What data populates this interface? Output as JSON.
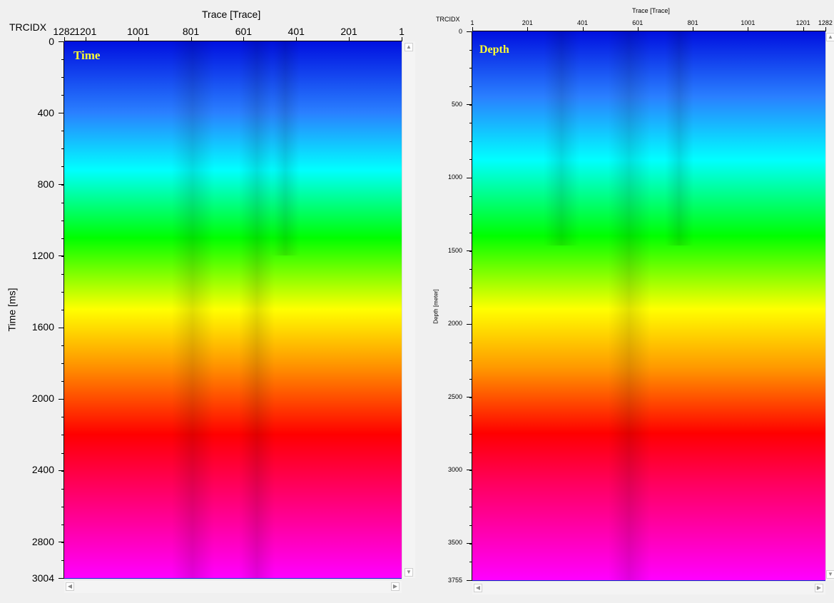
{
  "chart_data": [
    {
      "type": "heatmap",
      "title": "Time",
      "xlabel": "Trace [Trace]",
      "ylabel": "Time [ms]",
      "corner_label": "TRCIDX",
      "x_direction": "reversed",
      "xlim": [
        1282,
        1
      ],
      "ylim": [
        0,
        3004
      ],
      "x_ticks": [
        "1282",
        "1201",
        "1001",
        "801",
        "601",
        "401",
        "201",
        "1"
      ],
      "y_ticks": [
        "0",
        "400",
        "800",
        "1200",
        "1600",
        "2000",
        "2400",
        "2800",
        "3004"
      ],
      "y_tick_values": [
        0,
        400,
        800,
        1200,
        1600,
        2000,
        2400,
        2800,
        3004
      ],
      "color_bands": [
        {
          "color": "#0010e0",
          "value": 0
        },
        {
          "color": "#2a80ff",
          "value": 400
        },
        {
          "color": "#00ffff",
          "value": 720
        },
        {
          "color": "#00ff00",
          "value": 1100
        },
        {
          "color": "#ffff00",
          "value": 1500
        },
        {
          "color": "#ff9900",
          "value": 1800
        },
        {
          "color": "#ff0000",
          "value": 2200
        },
        {
          "color": "#ff0060",
          "value": 2500
        },
        {
          "color": "#ff00ff",
          "value": 3004
        }
      ]
    },
    {
      "type": "heatmap",
      "title": "Depth",
      "xlabel": "Trace [Trace]",
      "ylabel": "Depth [meter]",
      "corner_label": "TRCIDX",
      "x_direction": "normal",
      "xlim": [
        1,
        1282
      ],
      "ylim": [
        0,
        3755
      ],
      "x_ticks": [
        "1",
        "201",
        "401",
        "601",
        "801",
        "1001",
        "1201",
        "1282"
      ],
      "y_ticks": [
        "0",
        "500",
        "1000",
        "1500",
        "2000",
        "2500",
        "3000",
        "3500",
        "3755"
      ],
      "y_tick_values": [
        0,
        500,
        1000,
        1500,
        2000,
        2500,
        3000,
        3500,
        3755
      ],
      "color_bands": [
        {
          "color": "#0010e0",
          "value": 0
        },
        {
          "color": "#2a80ff",
          "value": 450
        },
        {
          "color": "#00ffff",
          "value": 880
        },
        {
          "color": "#00ff00",
          "value": 1400
        },
        {
          "color": "#ffff00",
          "value": 1900
        },
        {
          "color": "#ff9900",
          "value": 2300
        },
        {
          "color": "#ff0000",
          "value": 2750
        },
        {
          "color": "#ff0060",
          "value": 3100
        },
        {
          "color": "#ff00ff",
          "value": 3755
        }
      ]
    }
  ],
  "scroll_icons": {
    "up": "▲",
    "down": "▼",
    "left": "◀",
    "right": "▶"
  }
}
